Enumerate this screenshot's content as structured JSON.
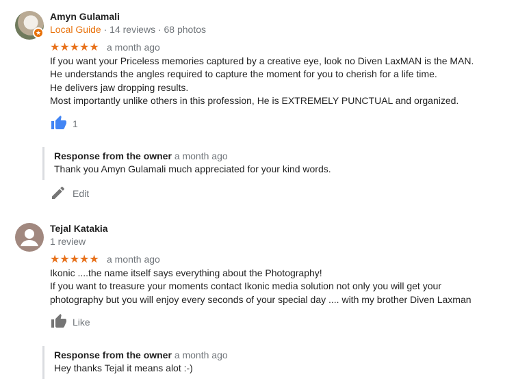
{
  "reviews": [
    {
      "reviewer_name": "Amyn Gulamali",
      "guide_label": "Local Guide",
      "stats": " · 14 reviews · 68 photos",
      "rating": 5,
      "stars": "★★★★★",
      "time": "a month ago",
      "body_lines": [
        "If you want your Priceless memories captured by a creative eye, look no Diven LaxMAN is the MAN.",
        "He understands the angles required to capture the moment for you to cherish for a life time.",
        "He delivers jaw dropping results.",
        "Most importantly unlike others in this profession, He is EXTREMELY PUNCTUAL and organized."
      ],
      "like_count": "1",
      "response": {
        "label": "Response from the owner",
        "time": "a month ago",
        "text": "Thank you Amyn Gulamali much appreciated for your kind words."
      },
      "edit_label": "Edit"
    },
    {
      "reviewer_name": "Tejal Katakia",
      "stats": "1 review",
      "rating": 5,
      "stars": "★★★★★",
      "time": "a month ago",
      "body_lines": [
        "Ikonic ....the name itself says everything about the Photography!",
        "If you want to treasure your moments contact Ikonic media solution not only you will get your",
        "photography but you will enjoy every seconds of your special day .... with my brother Diven Laxman"
      ],
      "like_label": "Like",
      "response": {
        "label": "Response from the owner",
        "time": "a month ago",
        "text": "Hey thanks Tejal it means alot :-)"
      }
    }
  ],
  "colors": {
    "accent": "#e8710a",
    "star": "#e7711b",
    "like_active": "#4285f4",
    "muted": "#70757a"
  },
  "icons": [
    "local-guide-badge-icon",
    "thumbs-up-icon",
    "edit-pencil-icon",
    "person-placeholder-icon"
  ]
}
